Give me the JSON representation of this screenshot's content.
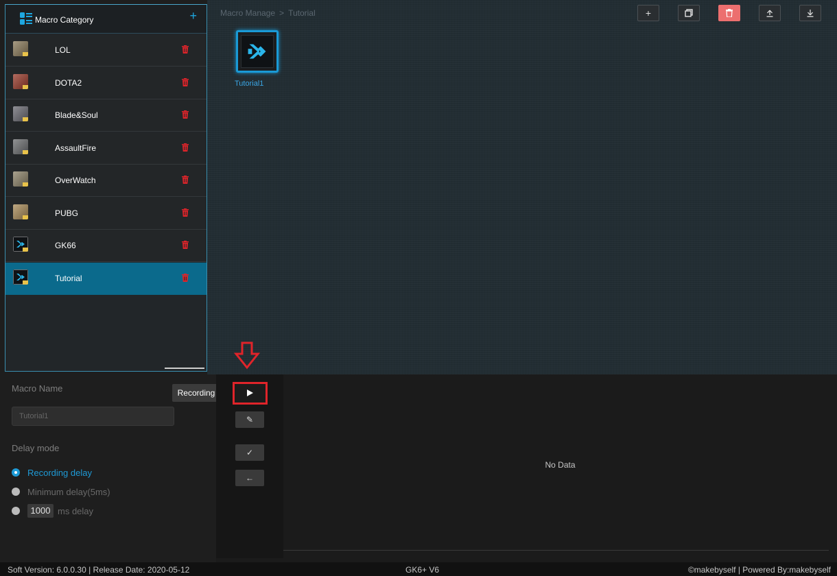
{
  "category_panel": {
    "title": "Macro Category",
    "add_icon": "plus-icon",
    "items": [
      {
        "label": "LOL",
        "thumb": "lol-thumbnail",
        "thumb_color": "#8a7a5a"
      },
      {
        "label": "DOTA2",
        "thumb": "dota2-thumbnail",
        "thumb_color": "#9a3a2a"
      },
      {
        "label": "Blade&Soul",
        "thumb": "blade-and-soul-thumbnail",
        "thumb_color": "#6a6a72"
      },
      {
        "label": "AssaultFire",
        "thumb": "assaultfire-thumbnail",
        "thumb_color": "#6c6e70"
      },
      {
        "label": "OverWatch",
        "thumb": "overwatch-thumbnail",
        "thumb_color": "#8c8268"
      },
      {
        "label": "PUBG",
        "thumb": "pubg-thumbnail",
        "thumb_color": "#a98b58"
      },
      {
        "label": "GK66",
        "thumb": "gk66-thumbnail",
        "thumb_color": "#0f1215"
      },
      {
        "label": "Tutorial",
        "thumb": "tutorial-thumbnail",
        "thumb_color": "#0f1215",
        "selected": true
      }
    ],
    "delete_icon": "trash-icon",
    "delete_color": "#e0242a"
  },
  "breadcrumb": {
    "root": "Macro Manage",
    "separator": ">",
    "current": "Tutorial"
  },
  "toolbar": {
    "buttons": [
      {
        "name": "new-macro-button",
        "icon": "plus-icon",
        "glyph": "+"
      },
      {
        "name": "copy-macro-button",
        "icon": "copy-icon",
        "glyph": "❐"
      },
      {
        "name": "delete-macro-button",
        "icon": "trash-icon",
        "glyph": "🗑",
        "color": "#ec6f6f"
      },
      {
        "name": "import-button",
        "icon": "upload-icon",
        "glyph": "⤒"
      },
      {
        "name": "export-button",
        "icon": "download-icon",
        "glyph": "⤓"
      }
    ]
  },
  "macro_files": [
    {
      "name": "Tutorial1",
      "icon": "macro-logo-icon",
      "selected": true
    }
  ],
  "macro_props": {
    "name_label": "Macro Name",
    "name_value": "Tutorial1",
    "delay_label": "Delay mode",
    "delay_options": [
      {
        "label": "Recording delay",
        "selected": true
      },
      {
        "label": "Minimum delay(5ms)",
        "selected": false
      },
      {
        "label": "ms delay",
        "value": "1000",
        "selected": false
      }
    ]
  },
  "record_panel": {
    "tooltip": "Recording",
    "buttons": [
      {
        "name": "record-button",
        "icon": "play-icon"
      },
      {
        "name": "edit-button",
        "icon": "pencil-icon",
        "glyph": "✎"
      },
      {
        "name": "confirm-button",
        "icon": "check-icon",
        "glyph": "✓"
      },
      {
        "name": "back-button",
        "icon": "arrow-left-icon",
        "glyph": "←"
      }
    ]
  },
  "events": {
    "empty_text": "No Data"
  },
  "status": {
    "left": "Soft Version: 6.0.0.30 | Release Date: 2020-05-12",
    "middle": "GK6+ V6",
    "right": "©makebyself | Powered By:makebyself"
  },
  "colors": {
    "accent": "#1e9bd7",
    "selection": "#0b6a8c",
    "danger": "#e0242a"
  }
}
